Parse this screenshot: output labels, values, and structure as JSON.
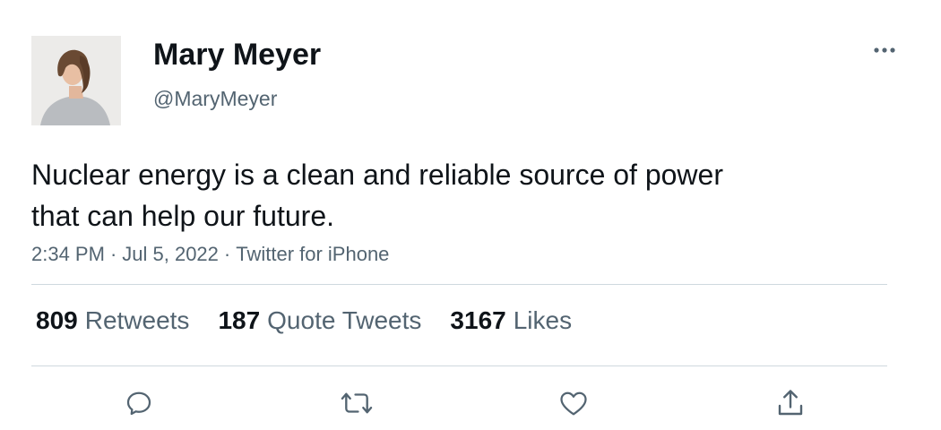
{
  "tweet": {
    "display_name": "Mary Meyer",
    "handle": "@MaryMeyer",
    "text_line1": "Nuclear energy is a clean and reliable source of power",
    "text_line2": "that can help our future.",
    "time": "2:34 PM",
    "date": "Jul 5, 2022",
    "source": "Twitter for iPhone",
    "separator": "·"
  },
  "stats": {
    "retweets": {
      "count": "809",
      "label": "Retweets"
    },
    "quote_tweets": {
      "count": "187",
      "label": "Quote Tweets"
    },
    "likes": {
      "count": "3167",
      "label": "Likes"
    }
  },
  "icons": {
    "more": "more-horizontal-icon",
    "reply": "reply-icon",
    "retweet": "retweet-icon",
    "like": "heart-icon",
    "share": "share-icon"
  },
  "colors": {
    "text_primary": "#0f1419",
    "text_secondary": "#536471",
    "divider": "#cfd9de",
    "icon": "#536471"
  }
}
